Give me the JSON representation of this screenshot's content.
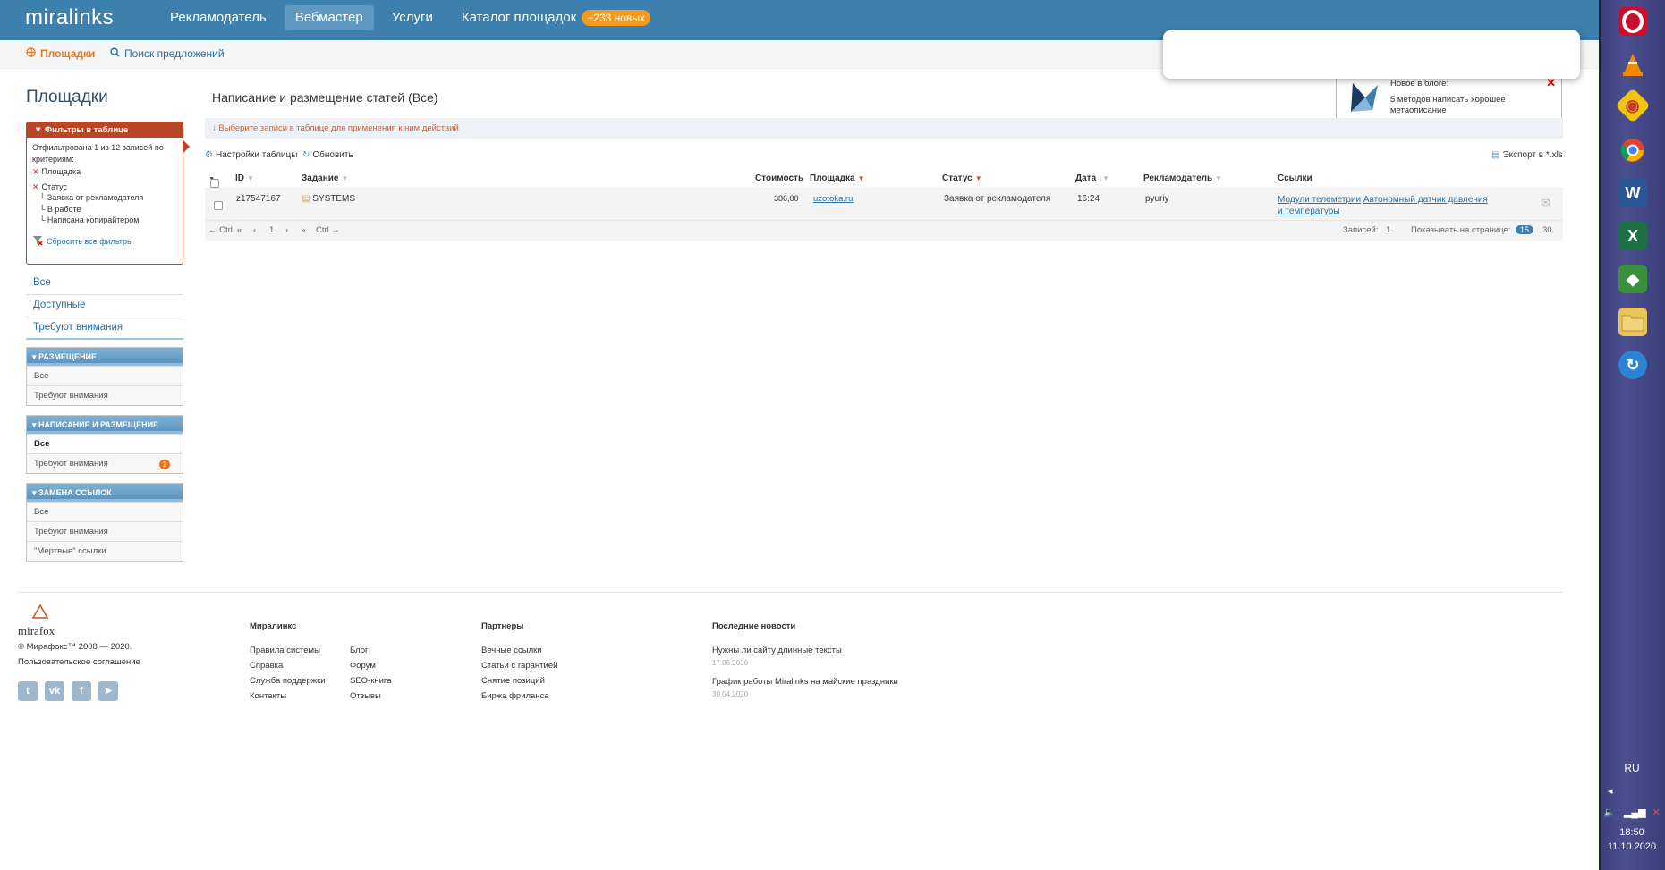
{
  "topbar": {
    "logo": "miralinks",
    "nav": [
      {
        "label": "Рекламодатель"
      },
      {
        "label": "Вебмастер"
      },
      {
        "label": "Услуги"
      },
      {
        "label": "Каталог площадок"
      }
    ],
    "catalog_badge": "+233 новых"
  },
  "subbar": {
    "sites": "Площадки",
    "search": "Поиск предложений"
  },
  "blog": {
    "title": "Новое в блоге:",
    "text": "5 методов написать хорошее метаописание"
  },
  "sidebar": {
    "title": "Площадки",
    "filters": {
      "header": "Фильтры в таблице",
      "summary": "Отфильтрована 1 из 12 записей по критериям:",
      "site": "Площадка",
      "status": "Статус",
      "status_items": [
        "Заявка от рекламодателя",
        "В работе",
        "Написана копирайтером"
      ],
      "reset": "Сбросить все фильтры"
    },
    "links": [
      "Все",
      "Доступные",
      "Требуют внимания"
    ],
    "sections": [
      {
        "title": "РАЗМЕЩЕНИЕ",
        "items": [
          "Все",
          "Требуют внимания"
        ]
      },
      {
        "title": "НАПИСАНИЕ И РАЗМЕЩЕНИЕ",
        "items": [
          "Все",
          "Требуют внимания"
        ],
        "count": "1"
      },
      {
        "title": "ЗАМЕНА ССЫЛОК",
        "items": [
          "Все",
          "Требуют внимания",
          "\"Мертвые\" ссылки"
        ]
      }
    ]
  },
  "main": {
    "title": "Написание и размещение статей (Все)",
    "info": "Выберите записи в таблице для применения к ним действий",
    "table_settings": "Настройки таблицы",
    "refresh": "Обновить",
    "export": "Экспорт в *.xls",
    "columns": [
      "ID",
      "Задание",
      "Стоимость",
      "Площадка",
      "Статус",
      "Дата",
      "Рекламодатель",
      "Ссылки"
    ],
    "rows": [
      {
        "id": "z17547167",
        "task": "SYSTEMS",
        "cost": "386,00",
        "site": "uzotoka.ru",
        "status": "Заявка от рекламодателя",
        "date": "16:24",
        "advertiser": "pyuriy",
        "link1": "Модули телеметрии",
        "link2": "Автономный датчик давления и температуры"
      }
    ],
    "pager": {
      "prev_hint": "← Ctrl",
      "first": "«",
      "prev": "‹",
      "page": "1",
      "next": "›",
      "last": "»",
      "next_hint": "Ctrl →",
      "records_label": "Записей:",
      "records": "1",
      "per_page_label": "Показывать на странице:",
      "per_page_active": "15",
      "per_page_other": "30"
    }
  },
  "footer": {
    "brand": "mirafox",
    "copyright": "© Мирафокс™ 2008 — 2020.",
    "agreement": "Пользовательское соглашение",
    "col1_title": "Миралинкс",
    "col1a": [
      "Правила системы",
      "Справка",
      "Служба поддержки",
      "Контакты"
    ],
    "col1b": [
      "Блог",
      "Форум",
      "SEO-книга",
      "Отзывы"
    ],
    "col2_title": "Партнеры",
    "col2": [
      "Вечные ссылки",
      "Статьи с гарантией",
      "Снятие позиций",
      "Биржа фриланса"
    ],
    "col3_title": "Последние новости",
    "news": [
      {
        "title": "Нужны ли сайту длинные тексты",
        "date": "17.06.2020"
      },
      {
        "title": "График работы Miralinks на майские праздники",
        "date": "30.04.2020"
      }
    ]
  },
  "taskbar": {
    "lang": "RU",
    "time": "18:50",
    "date": "11.10.2020"
  }
}
